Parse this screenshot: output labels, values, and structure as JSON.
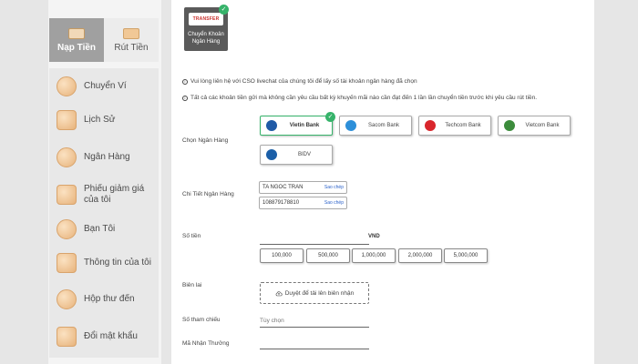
{
  "sidebar": {
    "tabs": [
      {
        "label": "Nạp Tiền",
        "active": true
      },
      {
        "label": "Rút Tiền",
        "active": false
      }
    ],
    "items": [
      {
        "label": "Chuyển Ví",
        "icon": "wallet-transfer-icon"
      },
      {
        "label": "Lịch Sử",
        "icon": "history-icon"
      },
      {
        "label": "Ngân Hàng",
        "icon": "bank-icon"
      },
      {
        "label": "Phiếu giảm giá của tôi",
        "icon": "coupon-icon"
      },
      {
        "label": "Bạn Tôi",
        "icon": "friends-icon"
      },
      {
        "label": "Thông tin của tôi",
        "icon": "profile-icon"
      },
      {
        "label": "Hộp thư đến",
        "icon": "inbox-icon"
      },
      {
        "label": "Đổi mật khẩu",
        "icon": "lock-icon"
      }
    ]
  },
  "channel": {
    "logo_text": "TRANSFER",
    "label": "Chuyển Khoản Ngân Hàng"
  },
  "notes": [
    "Vui lòng liên hệ với CSO livechat của chúng tôi để lấy số tài khoản ngân hàng đã chọn",
    "Tất cả các khoản tiền gửi mà không cần yêu cầu bất kỳ khuyến mãi nào cần đạt đến 1 lần lần chuyển tiền trước khi yêu cầu rút tiền."
  ],
  "form": {
    "bank_label": "Chọn Ngân Hàng",
    "detail_label": "Chi Tiết Ngân Hàng",
    "amount_label": "Số tiền",
    "receipt_label": "Biên lai",
    "reference_label": "Số tham chiếu",
    "promo_label": "Mã Nhận Thưởng",
    "currency": "VND",
    "reference_placeholder": "Tùy chọn",
    "upload_text": "Duyệt để tải lên biên nhận"
  },
  "banks": [
    {
      "name": "Vietin Bank",
      "color": "#1f5aa6",
      "selected": true
    },
    {
      "name": "Sacom Bank",
      "color": "#2d8fd9",
      "selected": false
    },
    {
      "name": "Techcom Bank",
      "color": "#d9262c",
      "selected": false
    },
    {
      "name": "Vietcom Bank",
      "color": "#3c8c3c",
      "selected": false
    },
    {
      "name": "BIDV",
      "color": "#1b5fa8",
      "selected": false
    }
  ],
  "bank_details": {
    "account_name": "TA NGOC TRAN",
    "account_number": "108879178810",
    "copy_label": "Sao chép"
  },
  "amounts": [
    "100,000",
    "500,000",
    "1,000,000",
    "2,000,000",
    "5,000,000"
  ],
  "colors": {
    "accent_check": "#36b36a",
    "active_tab": "#a0a0a0",
    "link": "#2a61c9"
  }
}
